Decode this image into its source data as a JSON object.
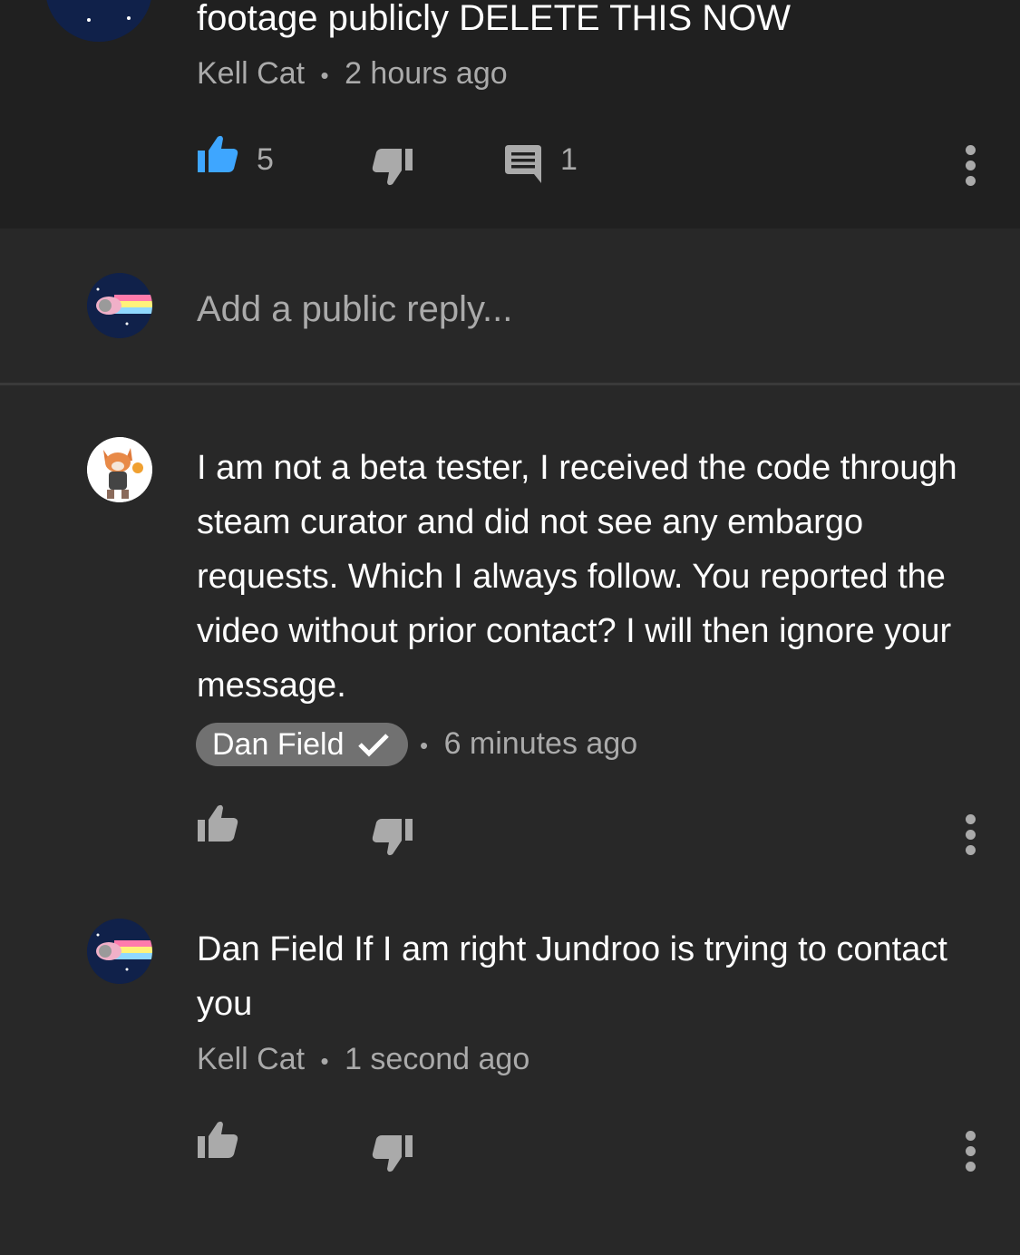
{
  "top_comment": {
    "text_tail": "footage publicly DELETE THIS NOW",
    "author": "Kell Cat",
    "separator": "•",
    "time": "2 hours ago",
    "likes": "5",
    "replies": "1",
    "liked": true
  },
  "reply_box": {
    "placeholder": "Add a public reply..."
  },
  "replies": [
    {
      "text": "I am not a beta tester, I received the code through steam curator and did not see any embargo requests. Which I always follow. You reported the video without prior contact? I will then ignore your message.",
      "author": "Dan Field",
      "verified_creator": true,
      "separator": "•",
      "time": "6 minutes ago"
    },
    {
      "text": "Dan Field If I am right Jundroo is trying to contact you",
      "author": "Kell Cat",
      "separator": "•",
      "time": "1 second ago"
    }
  ],
  "colors": {
    "background": "#282828",
    "top_section": "#202020",
    "liked_accent": "#3ea6ff",
    "muted_text": "#aaaaaa",
    "badge": "#717171"
  }
}
